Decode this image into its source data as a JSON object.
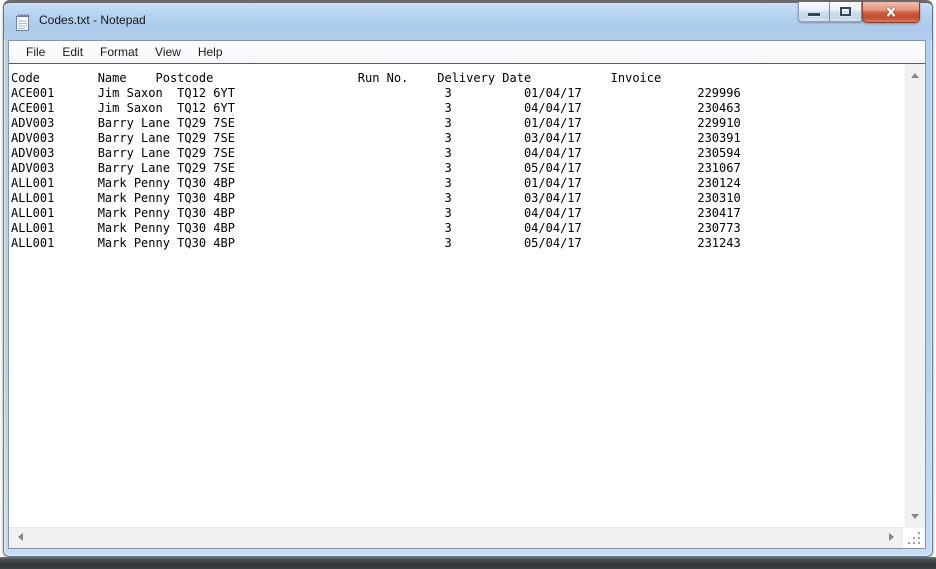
{
  "window": {
    "title": "Codes.txt - Notepad",
    "app_icon": "notepad-icon",
    "controls": [
      "minimize",
      "maximize",
      "close"
    ]
  },
  "menubar": {
    "items": [
      "File",
      "Edit",
      "Format",
      "View",
      "Help"
    ]
  },
  "editor": {
    "header_cols": [
      0,
      12,
      20,
      48,
      59,
      83
    ],
    "row_cols": [
      0,
      12,
      23,
      60,
      71,
      95
    ],
    "headers": [
      "Code",
      "Name",
      "Postcode",
      "Run No.",
      "Delivery Date",
      "Invoice"
    ],
    "rows": [
      [
        "ACE001",
        "Jim Saxon",
        "TQ12 6YT",
        "3",
        "01/04/17",
        "229996"
      ],
      [
        "ACE001",
        "Jim Saxon",
        "TQ12 6YT",
        "3",
        "04/04/17",
        "230463"
      ],
      [
        "ADV003",
        "Barry Lane",
        "TQ29 7SE",
        "3",
        "01/04/17",
        "229910"
      ],
      [
        "ADV003",
        "Barry Lane",
        "TQ29 7SE",
        "3",
        "03/04/17",
        "230391"
      ],
      [
        "ADV003",
        "Barry Lane",
        "TQ29 7SE",
        "3",
        "04/04/17",
        "230594"
      ],
      [
        "ADV003",
        "Barry Lane",
        "TQ29 7SE",
        "3",
        "05/04/17",
        "231067"
      ],
      [
        "ALL001",
        "Mark Penny",
        "TQ30 4BP",
        "3",
        "01/04/17",
        "230124"
      ],
      [
        "ALL001",
        "Mark Penny",
        "TQ30 4BP",
        "3",
        "03/04/17",
        "230310"
      ],
      [
        "ALL001",
        "Mark Penny",
        "TQ30 4BP",
        "3",
        "04/04/17",
        "230417"
      ],
      [
        "ALL001",
        "Mark Penny",
        "TQ30 4BP",
        "3",
        "04/04/17",
        "230773"
      ],
      [
        "ALL001",
        "Mark Penny",
        "TQ30 4BP",
        "3",
        "05/04/17",
        "231243"
      ]
    ],
    "scrollbars": {
      "vertical": true,
      "horizontal": true
    }
  },
  "colors": {
    "frame": "#b4d0ee",
    "titlebar": "#b7d3f1",
    "close_button": "#c14d32",
    "menu_bg": "#f6f8fa",
    "editor_top_border": "#40638a",
    "scrollbar_track": "#f1f1f1",
    "text": "#000000",
    "bottom_strip": "#34373b"
  }
}
